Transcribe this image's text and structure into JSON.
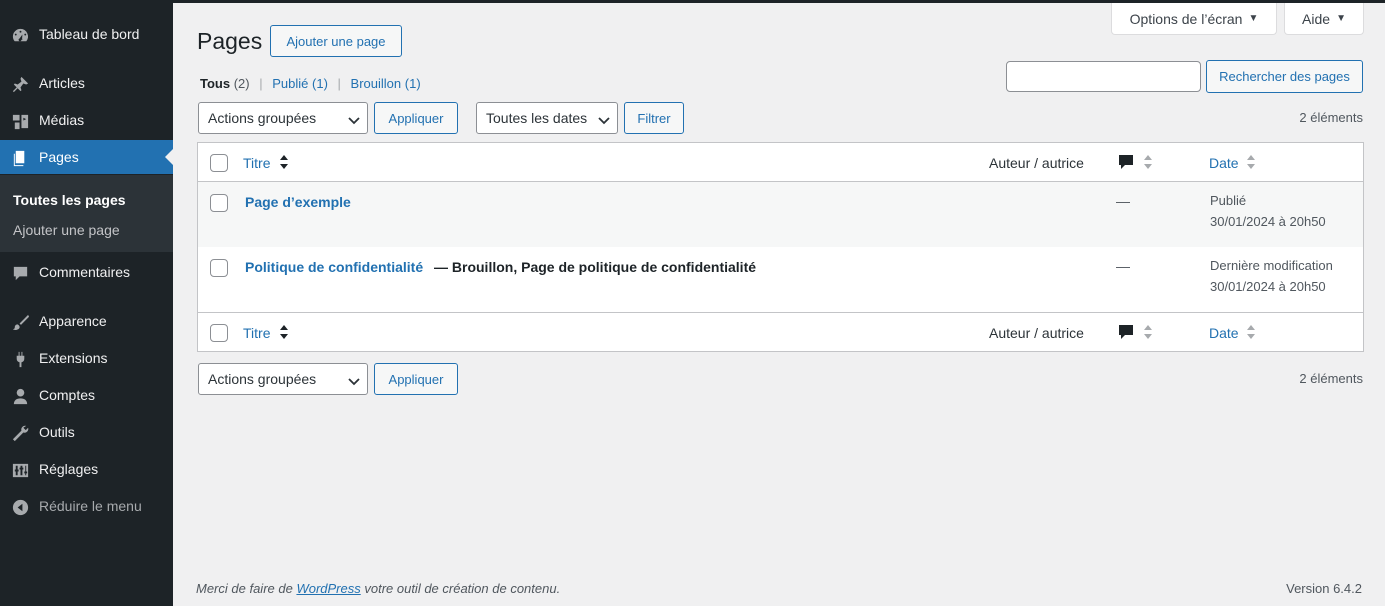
{
  "sidebar": {
    "items": [
      {
        "label": "Tableau de bord",
        "icon": "dashboard-icon"
      },
      {
        "label": "Articles",
        "icon": "pin-icon"
      },
      {
        "label": "Médias",
        "icon": "media-icon"
      },
      {
        "label": "Pages",
        "icon": "page-icon"
      },
      {
        "label": "Commentaires",
        "icon": "comment-icon"
      },
      {
        "label": "Apparence",
        "icon": "brush-icon"
      },
      {
        "label": "Extensions",
        "icon": "plugin-icon"
      },
      {
        "label": "Comptes",
        "icon": "user-icon"
      },
      {
        "label": "Outils",
        "icon": "wrench-icon"
      },
      {
        "label": "Réglages",
        "icon": "settings-sliders-icon"
      },
      {
        "label": "Réduire le menu",
        "icon": "collapse-icon"
      }
    ],
    "submenu": [
      {
        "label": "Toutes les pages"
      },
      {
        "label": "Ajouter une page"
      }
    ],
    "active_item": "Pages"
  },
  "screen_meta": {
    "options_label": "Options de l’écran",
    "help_label": "Aide"
  },
  "header": {
    "title": "Pages",
    "add_button": "Ajouter une page"
  },
  "filters": {
    "views": [
      {
        "label": "Tous",
        "count": "(2)"
      },
      {
        "label": "Publié",
        "count": "(1)"
      },
      {
        "label": "Brouillon",
        "count": "(1)"
      }
    ],
    "separator": "|",
    "search_value": "",
    "search_button": "Rechercher des pages",
    "bulk_actions": "Actions groupées",
    "apply": "Appliquer",
    "dates": "Toutes les dates",
    "filter": "Filtrer",
    "items_count": "2 éléments"
  },
  "table": {
    "columns": {
      "title": "Titre",
      "author": "Auteur / autrice",
      "date": "Date"
    },
    "rows": [
      {
        "title": "Page d’exemple",
        "state": "",
        "comments": "—",
        "date_status": "Publié",
        "date_value": "30/01/2024 à 20h50"
      },
      {
        "title": "Politique de confidentialité",
        "state": "— Brouillon, Page de politique de confidentialité",
        "comments": "—",
        "date_status": "Dernière modification",
        "date_value": "30/01/2024 à 20h50"
      }
    ]
  },
  "footer": {
    "thanks_before": "Merci de faire de ",
    "thanks_link": "WordPress",
    "thanks_after": " votre outil de création de contenu.",
    "version": "Version 6.4.2"
  },
  "colors": {
    "sidebar_bg": "#1d2327",
    "accent": "#2271b1",
    "page_bg": "#f0f0f1"
  }
}
